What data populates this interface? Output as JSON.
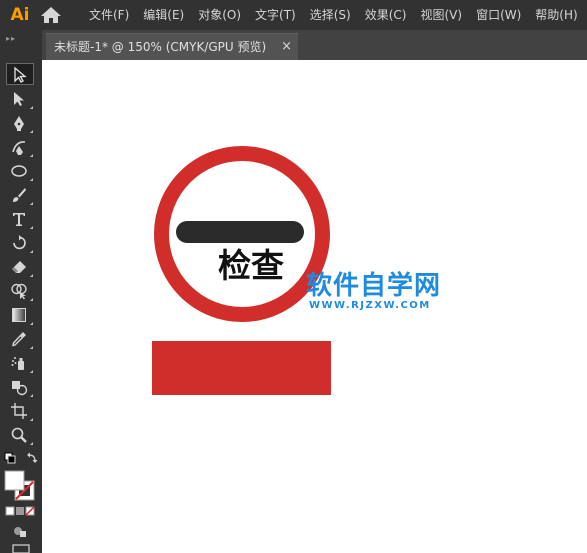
{
  "app": {
    "logo_text": "Ai"
  },
  "menu": [
    {
      "id": "file",
      "label": "文件(F)"
    },
    {
      "id": "edit",
      "label": "编辑(E)"
    },
    {
      "id": "object",
      "label": "对象(O)"
    },
    {
      "id": "type",
      "label": "文字(T)"
    },
    {
      "id": "select",
      "label": "选择(S)"
    },
    {
      "id": "effect",
      "label": "效果(C)"
    },
    {
      "id": "view",
      "label": "视图(V)"
    },
    {
      "id": "window",
      "label": "窗口(W)"
    },
    {
      "id": "help",
      "label": "帮助(H)"
    }
  ],
  "tab": {
    "title": "未标题-1* @ 150% (CMYK/GPU 预览)",
    "close": "×"
  },
  "tools": [
    "selection-tool-icon",
    "direct-selection-tool-icon",
    "pen-tool-icon",
    "curvature-tool-icon",
    "ellipse-tool-icon",
    "paintbrush-tool-icon",
    "type-tool-icon",
    "rotate-tool-icon",
    "eraser-tool-icon",
    "shape-builder-tool-icon",
    "gradient-tool-icon",
    "eyedropper-tool-icon",
    "symbol-sprayer-tool-icon",
    "live-paint-tool-icon",
    "artboard-tool-icon",
    "zoom-tool-icon"
  ],
  "artwork": {
    "sign_text": "检查",
    "ring_color": "#d12d2a",
    "bar_color": "#2b2b2b",
    "rect_color": "#cf2e2b"
  },
  "watermark": {
    "title": "软件自学网",
    "url": "WWW.RJZXW.COM",
    "color": "#1e8be0"
  }
}
